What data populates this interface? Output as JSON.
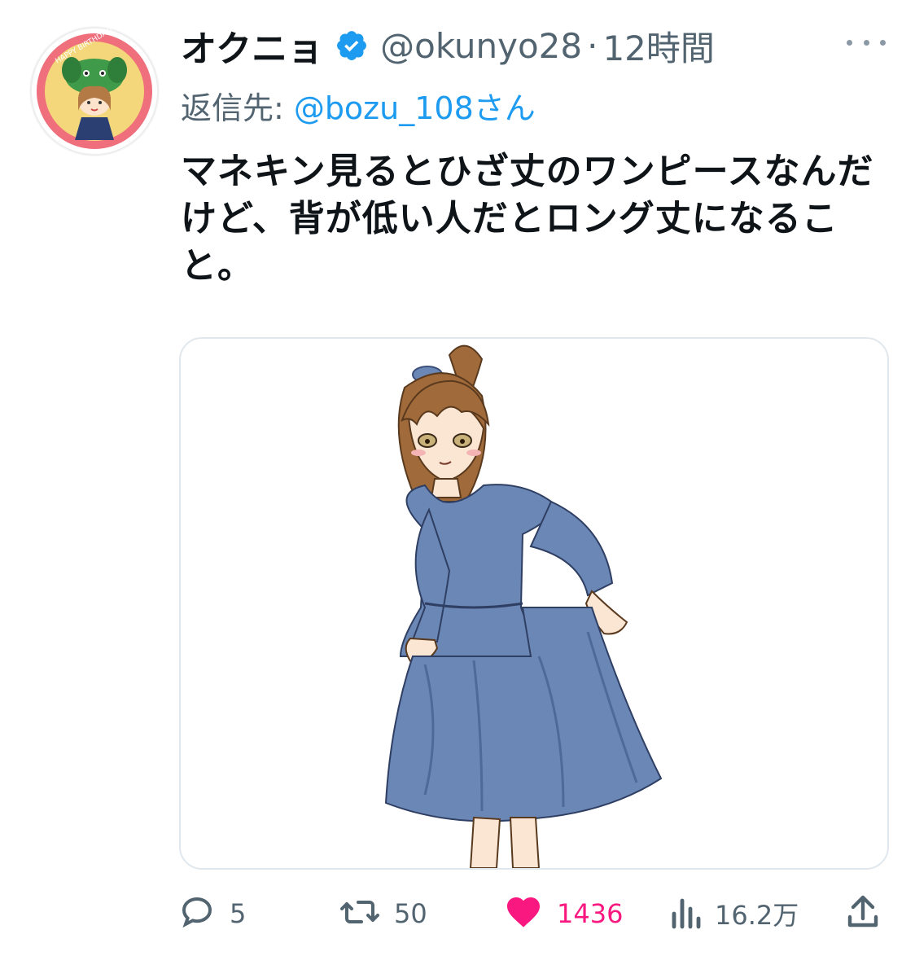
{
  "tweet": {
    "display_name": "オクニョ",
    "handle": "@okunyo28",
    "separator": "·",
    "time": "12時間",
    "reply_prefix": "返信先:",
    "reply_handle": "@bozu_108さん",
    "text": "マネキン見るとひざ丈のワンピースなんだけど、背が低い人だとロング丈になること。",
    "verified": true
  },
  "avatar": {
    "badge_text": "HAPPY BIRTHDAY!",
    "ring_color": "#ef6f7c"
  },
  "media": {
    "description_icon": "illustration-woman-blue-dress",
    "dress_color": "#6b87b5",
    "hair_color": "#a06a3a"
  },
  "actions": {
    "reply": {
      "icon": "reply-icon",
      "count": "5"
    },
    "retweet": {
      "icon": "retweet-icon",
      "count": "50"
    },
    "like": {
      "icon": "heart-icon",
      "count": "1436",
      "liked": true,
      "color": "#f91880"
    },
    "views": {
      "icon": "views-icon",
      "count": "16.2万"
    },
    "share": {
      "icon": "share-icon"
    }
  },
  "colors": {
    "text_primary": "#0f1419",
    "text_secondary": "#536471",
    "link": "#1d9bf0",
    "verified": "#1d9bf0"
  }
}
